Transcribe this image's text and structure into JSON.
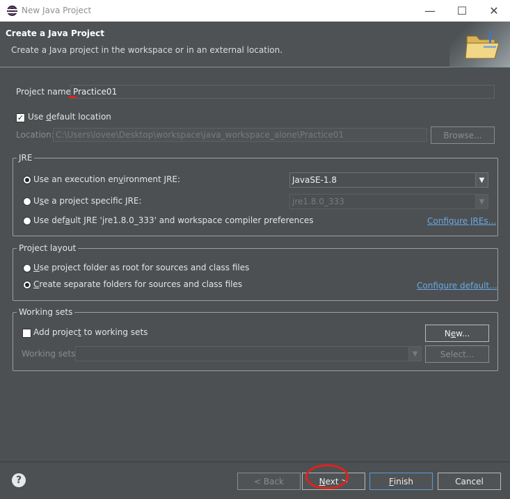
{
  "window": {
    "title": "New Java Project",
    "minimize_glyph": "—",
    "maximize_glyph": "☐",
    "close_glyph": "✕"
  },
  "banner": {
    "title": "Create a Java Project",
    "description": "Create a Java project in the workspace or in an external location.",
    "icon": "folder-new-icon"
  },
  "project": {
    "name_label": "Project name:",
    "name_value": "Practice01",
    "use_default_location_pre": "Use ",
    "use_default_location_mn": "d",
    "use_default_location_post": "efault location",
    "use_default_location_checked": true,
    "location_label": "Location:",
    "location_value": "C:\\Users\\lovee\\Desktop\\workspace\\java_workspace_alone\\Practice01",
    "browse_label": "Browse..."
  },
  "jre": {
    "group_title": "JRE",
    "opt1_pre": "Use an execution en",
    "opt1_mn": "v",
    "opt1_post": "ironment JRE:",
    "opt1_value": "JavaSE-1.8",
    "opt2_pre": "U",
    "opt2_mn": "s",
    "opt2_post": "e a project specific JRE:",
    "opt2_value": "jre1.8.0_333",
    "opt3_pre": "Use def",
    "opt3_mn": "a",
    "opt3_post": "ult JRE 'jre1.8.0_333' and workspace compiler preferences",
    "configure_link": "Configure JREs...",
    "selected": 1
  },
  "layout": {
    "group_title": "Project layout",
    "opt1_pre": "",
    "opt1_mn": "U",
    "opt1_post": "se project folder as root for sources and class files",
    "opt2_pre": "",
    "opt2_mn": "C",
    "opt2_post": "reate separate folders for sources and class files",
    "configure_link": "Configure default...",
    "selected": 2
  },
  "working_sets": {
    "group_title": "Working sets",
    "add_pre": "Add projec",
    "add_mn": "t",
    "add_post": " to working sets",
    "add_checked": false,
    "new_pre": "N",
    "new_mn": "e",
    "new_post": "w...",
    "sets_label": "Working sets:",
    "select_label": "Select..."
  },
  "footer": {
    "help_glyph": "?",
    "back_label": "< Back",
    "next_pre": "",
    "next_mn": "N",
    "next_post": "ext >",
    "finish_pre": "",
    "finish_mn": "F",
    "finish_post": "inish",
    "cancel_label": "Cancel"
  },
  "colors": {
    "background": "#4c5052",
    "link": "#6aa9e6",
    "annotation": "#e0221c"
  }
}
